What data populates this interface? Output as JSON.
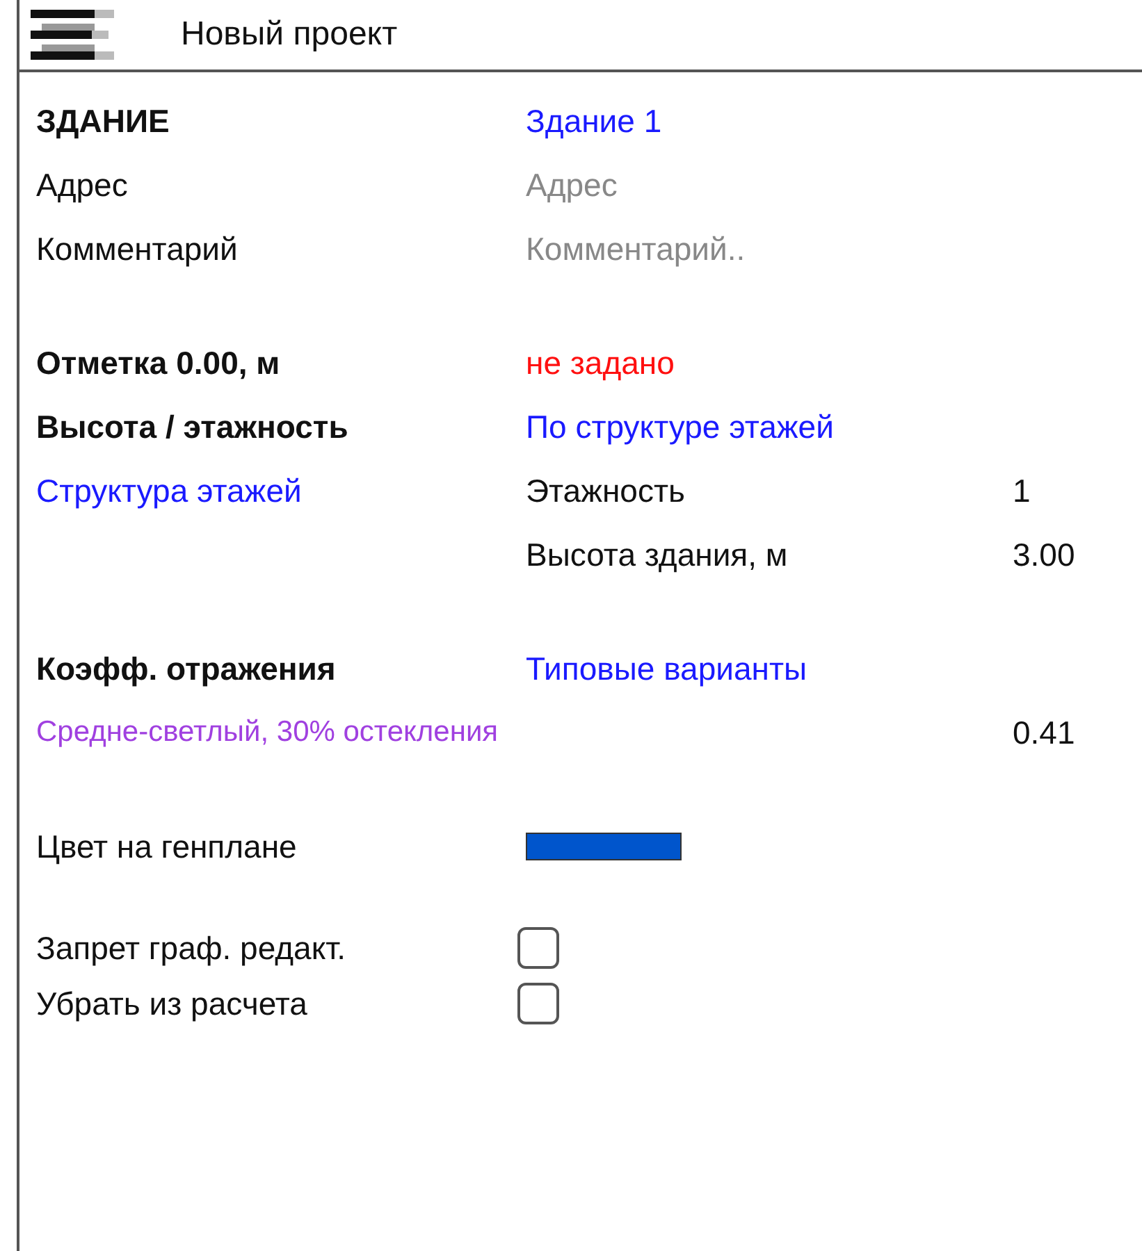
{
  "header": {
    "title": "Новый проект"
  },
  "building": {
    "label": "ЗДАНИЕ",
    "name": "Здание 1"
  },
  "fields": [
    {
      "label": "Адрес",
      "placeholder": "Адрес"
    },
    {
      "label": "Комментарий",
      "placeholder": "Комментарий.."
    }
  ],
  "elevation": {
    "label": "Отметка 0.00, м",
    "value": "не задано"
  },
  "height": {
    "label": "Высота / этажность",
    "mode": "По структуре этажей",
    "structure_link": "Структура этажей"
  },
  "height_values": [
    {
      "label": "Этажность",
      "value": "1"
    },
    {
      "label": "Высота здания, м",
      "value": "3.00"
    }
  ],
  "reflection": {
    "label": "Коэфф. отражения",
    "link": "Типовые варианты",
    "preset": "Средне-светлый, 30% остекления",
    "value": "0.41"
  },
  "plan_color": {
    "label": "Цвет на генплане",
    "color": "#0055cc"
  },
  "checkboxes": [
    {
      "label": "Запрет граф. редакт.",
      "checked": false
    },
    {
      "label": "Убрать из расчета",
      "checked": false
    }
  ]
}
